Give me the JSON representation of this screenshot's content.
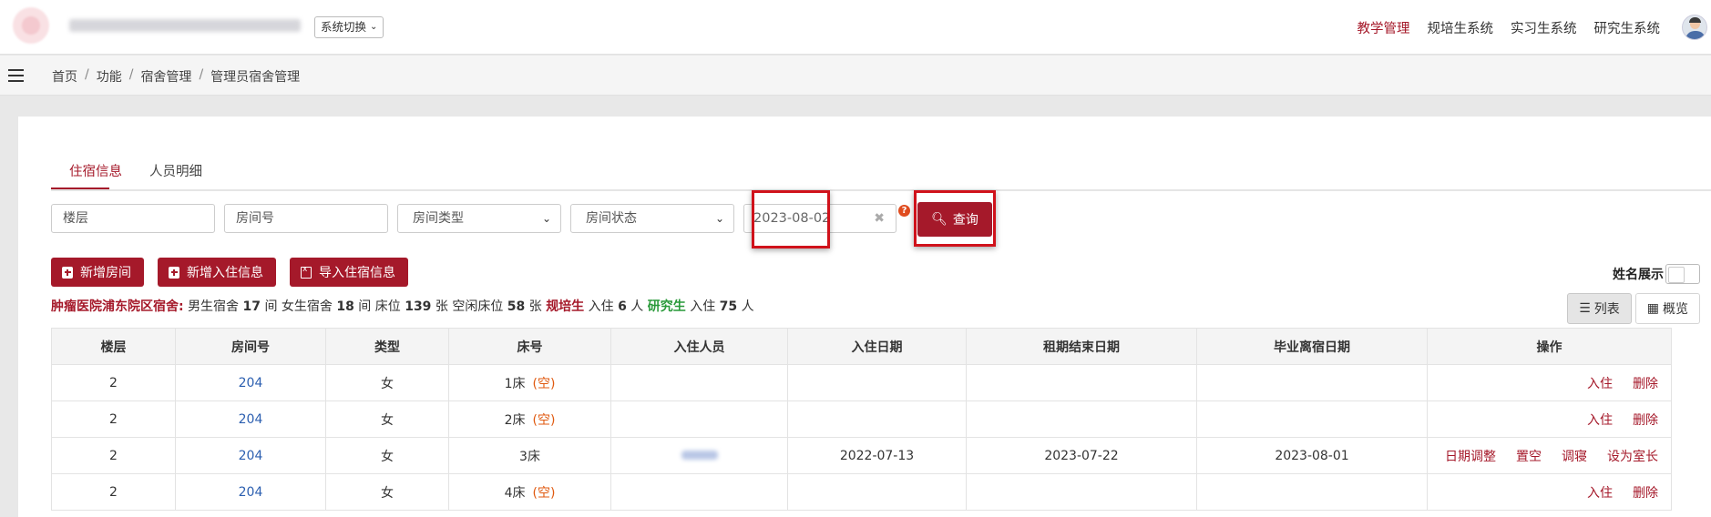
{
  "header": {
    "system_switch": "系统切换",
    "nav": [
      "教学管理",
      "规培生系统",
      "实习生系统",
      "研究生系统"
    ],
    "active_nav": "教学管理"
  },
  "breadcrumb": [
    "首页",
    "功能",
    "宿舍管理",
    "管理员宿舍管理"
  ],
  "tabs": [
    "住宿信息",
    "人员明细"
  ],
  "filters": {
    "floor_placeholder": "楼层",
    "room_placeholder": "房间号",
    "room_type": "房间类型",
    "room_status": "房间状态",
    "date": "2023-08-02",
    "search_label": "查询"
  },
  "actions": {
    "add_room": "新增房间",
    "add_checkin": "新增入住信息",
    "import": "导入住宿信息"
  },
  "name_toggle": "姓名展示",
  "stats": {
    "campus": "肿瘤医院浦东院区宿舍:",
    "male_label": "男生宿舍",
    "male_count": "17",
    "unit_room": "间",
    "female_label": "女生宿舍",
    "female_count": "18",
    "bed_label": "床位",
    "bed_count": "139",
    "unit_bed": "张",
    "free_label": "空闲床位",
    "free_count": "58",
    "gp_label": "规培生",
    "checkin_label": "入住",
    "gp_count": "6",
    "unit_person": "人",
    "gs_label": "研究生",
    "gs_count": "75"
  },
  "view": {
    "list": "列表",
    "overview": "概览"
  },
  "table": {
    "columns": [
      "楼层",
      "房间号",
      "类型",
      "床号",
      "入住人员",
      "入住日期",
      "租期结束日期",
      "毕业离宿日期",
      "操作"
    ],
    "empty_mark": "(空)",
    "rows": [
      {
        "floor": "2",
        "room": "204",
        "type": "女",
        "bed": "1床",
        "empty": true,
        "person": "",
        "in_date": "",
        "end_date": "",
        "leave_date": "",
        "ops": [
          "入住",
          "删除"
        ]
      },
      {
        "floor": "2",
        "room": "204",
        "type": "女",
        "bed": "2床",
        "empty": true,
        "person": "",
        "in_date": "",
        "end_date": "",
        "leave_date": "",
        "ops": [
          "入住",
          "删除"
        ]
      },
      {
        "floor": "2",
        "room": "204",
        "type": "女",
        "bed": "3床",
        "empty": false,
        "person": "blurred",
        "in_date": "2022-07-13",
        "end_date": "2023-07-22",
        "leave_date": "2023-08-01",
        "ops": [
          "日期调整",
          "置空",
          "调寝",
          "设为室长"
        ]
      },
      {
        "floor": "2",
        "room": "204",
        "type": "女",
        "bed": "4床",
        "empty": true,
        "person": "",
        "in_date": "",
        "end_date": "",
        "leave_date": "",
        "ops": [
          "入住",
          "删除"
        ]
      }
    ]
  }
}
